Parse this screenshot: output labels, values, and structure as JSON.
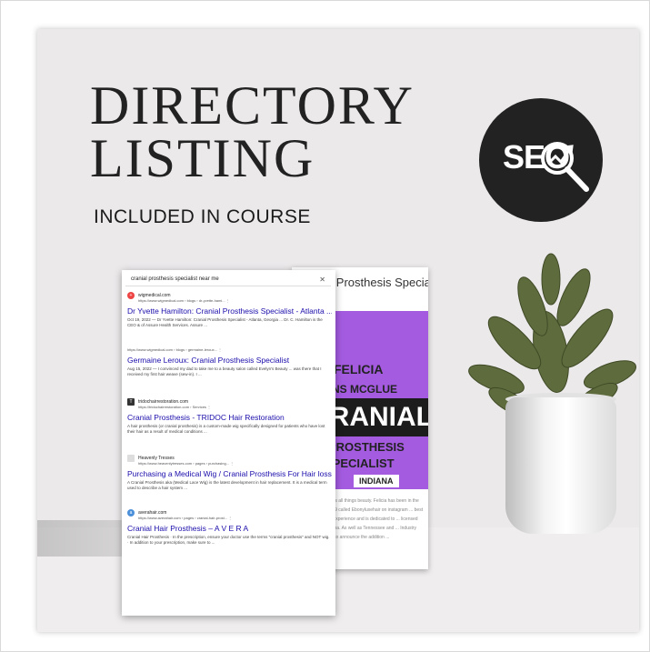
{
  "title_line1": "DIRECTORY",
  "title_line2": "LISTING",
  "subtitle": "INCLUDED IN COURSE",
  "badge_text": "SEO",
  "search_query": "cranial prosthesis specialist near me",
  "results": [
    {
      "site": "wigmedical.com",
      "url": "https://www.wigmedical.com › blogs › dr-yvette-hami... ⋮",
      "title": "Dr Yvette Hamilton: Cranial Prosthesis Specialist - Atlanta ...",
      "snippet": "Oct 19, 2022 — Dr Yvette Hamilton: Cranial Prosthesis Specialist - Atlanta, Georgia ... Dr. C. Hamilton is the CEO & of Assure Health Services. Assure ..."
    },
    {
      "site": "",
      "url": "https://www.wigmedical.com › blogs › germaine-leroux... ⋮",
      "title": "Germaine Leroux: Cranial Prosthesis Specialist",
      "snippet": "Aug 15, 2022 — I convinced my dad to take me to a beauty salon called Evelyn's Beauty ... was there that I received my first hair weave (sew-in). I ..."
    },
    {
      "site": "tridochairrestoration.com",
      "url": "https://tridochairrestoration.com › Services ⋮",
      "title": "Cranial Prosthesis - TRIDOC Hair Restoration",
      "snippet": "A hair prosthesis (or cranial prosthesis) is a custom-made wig specifically designed for patients who have lost their hair as a result of medical conditions ..."
    },
    {
      "site": "Heavenly Tresses",
      "url": "https://www.heavenlytresses.com › pages › purchasing... ⋮",
      "title": "Purchasing a Medical Wig / Cranial Prosthesis For Hair loss",
      "snippet": "A Cranial Prosthesis aka (Medical Lace Wig) is the latest development in hair replacement. It is a medical term used to describe a hair system ..."
    },
    {
      "site": "averahair.com",
      "url": "https://www.averahair.com › pages › cranial-hair-prost... ⋮",
      "title": "Cranial Hair Prosthesis – A V E R A",
      "snippet": "Cranial Hair Prosthesis · In the prescription, ensure your doctor use the terms \"cranial prosthesis\" and NOT wig. · In addition to your prescription, make sure to ..."
    }
  ],
  "listing": {
    "header": "Cranial Prosthesis Specia",
    "name1": "FELICIA",
    "name2": "COLLINS MCGLUE",
    "band": "CRANIAL",
    "line3": "PROSTHESIS",
    "line4": "SPECIALIST",
    "tag": "INDIANA",
    "dots": "○○○",
    "body": "special. Felicia loves all things beauty. Felicia has been in the company since 2009 called Ebonyluxehair on instagram ... best possible shopping experience and is dedicated to ... licensed businesses in Indiana. As well as Tennessee and ... Industry LOCs hair is proud to announce the addition ..."
  }
}
